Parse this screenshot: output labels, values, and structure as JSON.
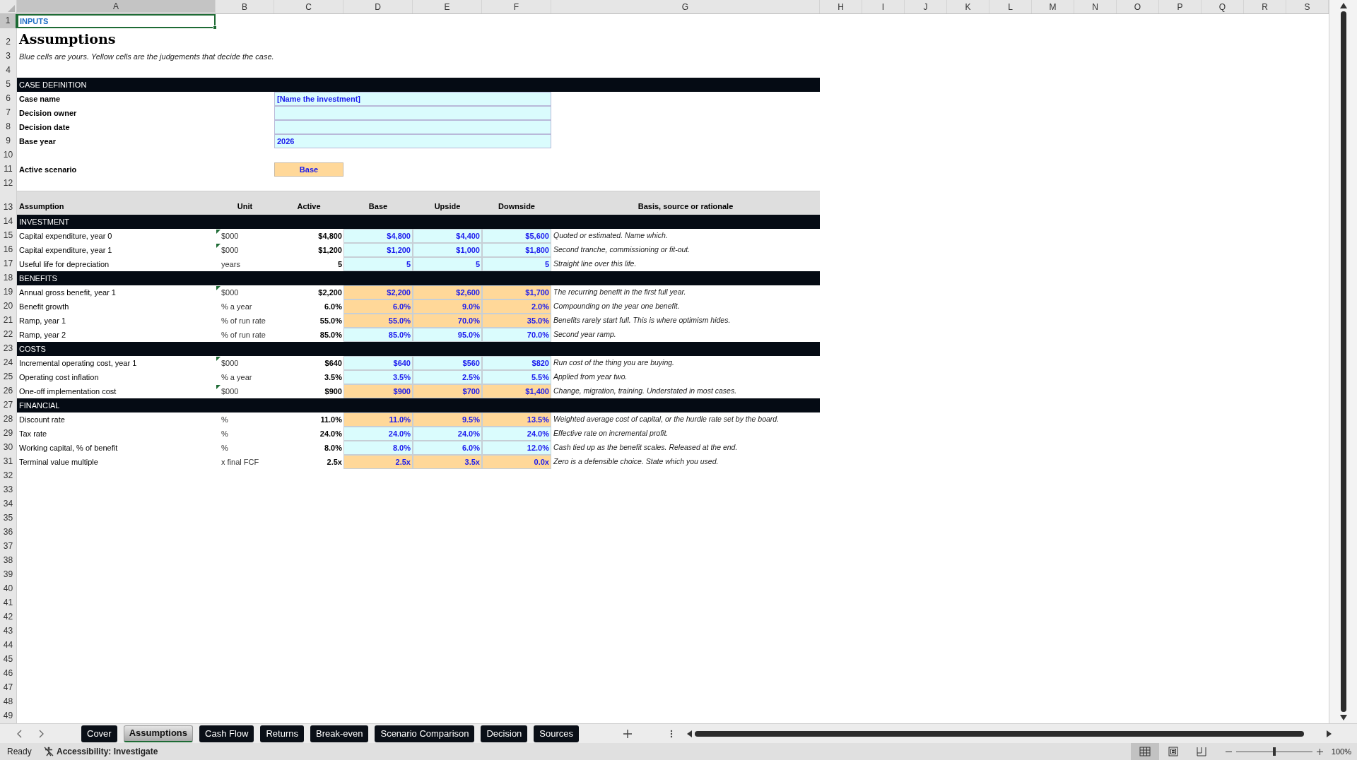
{
  "column_headers": [
    {
      "label": "A",
      "selected": true
    },
    {
      "label": "B",
      "selected": false
    },
    {
      "label": "C",
      "selected": false
    },
    {
      "label": "D",
      "selected": false
    },
    {
      "label": "E",
      "selected": false
    },
    {
      "label": "F",
      "selected": false
    },
    {
      "label": "G",
      "selected": false
    },
    {
      "label": "H",
      "selected": false
    },
    {
      "label": "I",
      "selected": false
    },
    {
      "label": "J",
      "selected": false
    },
    {
      "label": "K",
      "selected": false
    },
    {
      "label": "L",
      "selected": false
    },
    {
      "label": "M",
      "selected": false
    },
    {
      "label": "N",
      "selected": false
    },
    {
      "label": "O",
      "selected": false
    },
    {
      "label": "P",
      "selected": false
    },
    {
      "label": "Q",
      "selected": false
    },
    {
      "label": "R",
      "selected": false
    },
    {
      "label": "S",
      "selected": false
    }
  ],
  "row_numbers": [
    {
      "label": "1",
      "selected": true
    },
    {
      "label": "2",
      "selected": false
    },
    {
      "label": "3",
      "selected": false
    },
    {
      "label": "4",
      "selected": false
    },
    {
      "label": "5",
      "selected": false
    },
    {
      "label": "6",
      "selected": false
    },
    {
      "label": "7",
      "selected": false
    },
    {
      "label": "8",
      "selected": false
    },
    {
      "label": "9",
      "selected": false
    },
    {
      "label": "10",
      "selected": false
    },
    {
      "label": "11",
      "selected": false
    },
    {
      "label": "12",
      "selected": false
    },
    {
      "label": "13",
      "selected": false
    },
    {
      "label": "14",
      "selected": false
    },
    {
      "label": "15",
      "selected": false
    },
    {
      "label": "16",
      "selected": false
    },
    {
      "label": "17",
      "selected": false
    },
    {
      "label": "18",
      "selected": false
    },
    {
      "label": "19",
      "selected": false
    },
    {
      "label": "20",
      "selected": false
    },
    {
      "label": "21",
      "selected": false
    },
    {
      "label": "22",
      "selected": false
    },
    {
      "label": "23",
      "selected": false
    },
    {
      "label": "24",
      "selected": false
    },
    {
      "label": "25",
      "selected": false
    },
    {
      "label": "26",
      "selected": false
    },
    {
      "label": "27",
      "selected": false
    },
    {
      "label": "28",
      "selected": false
    },
    {
      "label": "29",
      "selected": false
    },
    {
      "label": "30",
      "selected": false
    },
    {
      "label": "31",
      "selected": false
    },
    {
      "label": "32",
      "selected": false
    },
    {
      "label": "33",
      "selected": false
    },
    {
      "label": "34",
      "selected": false
    },
    {
      "label": "35",
      "selected": false
    },
    {
      "label": "36",
      "selected": false
    },
    {
      "label": "37",
      "selected": false
    },
    {
      "label": "38",
      "selected": false
    },
    {
      "label": "39",
      "selected": false
    },
    {
      "label": "40",
      "selected": false
    },
    {
      "label": "41",
      "selected": false
    },
    {
      "label": "42",
      "selected": false
    },
    {
      "label": "43",
      "selected": false
    },
    {
      "label": "44",
      "selected": false
    },
    {
      "label": "45",
      "selected": false
    },
    {
      "label": "46",
      "selected": false
    },
    {
      "label": "47",
      "selected": false
    },
    {
      "label": "48",
      "selected": false
    },
    {
      "label": "49",
      "selected": false
    }
  ],
  "sheet": {
    "tag": "INPUTS",
    "title": "Assumptions",
    "subtitle": "Blue cells are yours. Yellow cells are the judgements that decide the case.",
    "case_definition": {
      "heading": "CASE DEFINITION",
      "fields": [
        {
          "label": "Case name",
          "value": "[Name the investment]"
        },
        {
          "label": "Decision owner"
        },
        {
          "label": "Decision date"
        },
        {
          "label": "Base year",
          "value": "2026"
        }
      ]
    },
    "active_scenario": {
      "label": "Active scenario",
      "value": "Base"
    },
    "table": {
      "columns": [
        "Assumption",
        "Unit",
        "Active",
        "Base",
        "Upside",
        "Downside",
        "Basis, source or rationale"
      ],
      "sections": [
        {
          "heading": "INVESTMENT",
          "rows": [
            {
              "label": "Capital expenditure, year 0",
              "unit": "$000",
              "has_comment": true,
              "active": "$4,800",
              "base": "$4,800",
              "upside": "$4,400",
              "downside": "$5,600",
              "note": "Quoted or estimated. Name which.",
              "kind": "input"
            },
            {
              "label": "Capital expenditure, year 1",
              "unit": "$000",
              "has_comment": true,
              "active": "$1,200",
              "base": "$1,200",
              "upside": "$1,000",
              "downside": "$1,800",
              "note": "Second tranche, commissioning or fit-out.",
              "kind": "input"
            },
            {
              "label": "Useful life for depreciation",
              "unit": "years",
              "has_comment": false,
              "active": "5",
              "base": "5",
              "upside": "5",
              "downside": "5",
              "note": "Straight line over this life.",
              "kind": "input"
            }
          ]
        },
        {
          "heading": "BENEFITS",
          "rows": [
            {
              "label": "Annual gross benefit, year 1",
              "unit": "$000",
              "has_comment": true,
              "active": "$2,200",
              "base": "$2,200",
              "upside": "$2,600",
              "downside": "$1,700",
              "note": "The recurring benefit in the first full year.",
              "kind": "judgement"
            },
            {
              "label": "Benefit growth",
              "unit": "% a year",
              "has_comment": false,
              "active": "6.0%",
              "base": "6.0%",
              "upside": "9.0%",
              "downside": "2.0%",
              "note": "Compounding on the year one benefit.",
              "kind": "judgement"
            },
            {
              "label": "Ramp, year 1",
              "unit": "% of run rate",
              "has_comment": false,
              "active": "55.0%",
              "base": "55.0%",
              "upside": "70.0%",
              "downside": "35.0%",
              "note": "Benefits rarely start full. This is where optimism hides.",
              "kind": "judgement"
            },
            {
              "label": "Ramp, year 2",
              "unit": "% of run rate",
              "has_comment": false,
              "active": "85.0%",
              "base": "85.0%",
              "upside": "95.0%",
              "downside": "70.0%",
              "note": "Second year ramp.",
              "kind": "input"
            }
          ]
        },
        {
          "heading": "COSTS",
          "rows": [
            {
              "label": "Incremental operating cost, year 1",
              "unit": "$000",
              "has_comment": true,
              "active": "$640",
              "base": "$640",
              "upside": "$560",
              "downside": "$820",
              "note": "Run cost of the thing you are buying.",
              "kind": "input"
            },
            {
              "label": "Operating cost inflation",
              "unit": "% a year",
              "has_comment": false,
              "active": "3.5%",
              "base": "3.5%",
              "upside": "2.5%",
              "downside": "5.5%",
              "note": "Applied from year two.",
              "kind": "input"
            },
            {
              "label": "One-off implementation cost",
              "unit": "$000",
              "has_comment": true,
              "active": "$900",
              "base": "$900",
              "upside": "$700",
              "downside": "$1,400",
              "note": "Change, migration, training. Understated in most cases.",
              "kind": "judgement"
            }
          ]
        },
        {
          "heading": "FINANCIAL",
          "rows": [
            {
              "label": "Discount rate",
              "unit": "%",
              "has_comment": false,
              "active": "11.0%",
              "base": "11.0%",
              "upside": "9.5%",
              "downside": "13.5%",
              "note": "Weighted average cost of capital, or the hurdle rate set by the board.",
              "kind": "judgement"
            },
            {
              "label": "Tax rate",
              "unit": "%",
              "has_comment": false,
              "active": "24.0%",
              "base": "24.0%",
              "upside": "24.0%",
              "downside": "24.0%",
              "note": "Effective rate on incremental profit.",
              "kind": "input"
            },
            {
              "label": "Working capital, % of benefit",
              "unit": "%",
              "has_comment": false,
              "active": "8.0%",
              "base": "8.0%",
              "upside": "6.0%",
              "downside": "12.0%",
              "note": "Cash tied up as the benefit scales. Released at the end.",
              "kind": "input"
            },
            {
              "label": "Terminal value multiple",
              "unit": "x final FCF",
              "has_comment": false,
              "active": "2.5x",
              "base": "2.5x",
              "upside": "3.5x",
              "downside": "0.0x",
              "note": "Zero is a defensible choice. State which you used.",
              "kind": "judgement"
            }
          ]
        }
      ]
    }
  },
  "sheet_tabs": [
    {
      "label": "Cover",
      "selected": false
    },
    {
      "label": "Assumptions",
      "selected": true
    },
    {
      "label": "Cash Flow",
      "selected": false
    },
    {
      "label": "Returns",
      "selected": false
    },
    {
      "label": "Break-even",
      "selected": false
    },
    {
      "label": "Scenario Comparison",
      "selected": false
    },
    {
      "label": "Decision",
      "selected": false
    },
    {
      "label": "Sources",
      "selected": false
    }
  ],
  "status_bar": {
    "mode": "Ready",
    "accessibility": "Accessibility: Investigate",
    "views": [
      {
        "kind": "normal",
        "selected": true
      },
      {
        "kind": "page_layout",
        "selected": false
      },
      {
        "kind": "page_break",
        "selected": false
      }
    ],
    "zoom_slider": {
      "level": 0.5
    },
    "zoom": "100%"
  }
}
